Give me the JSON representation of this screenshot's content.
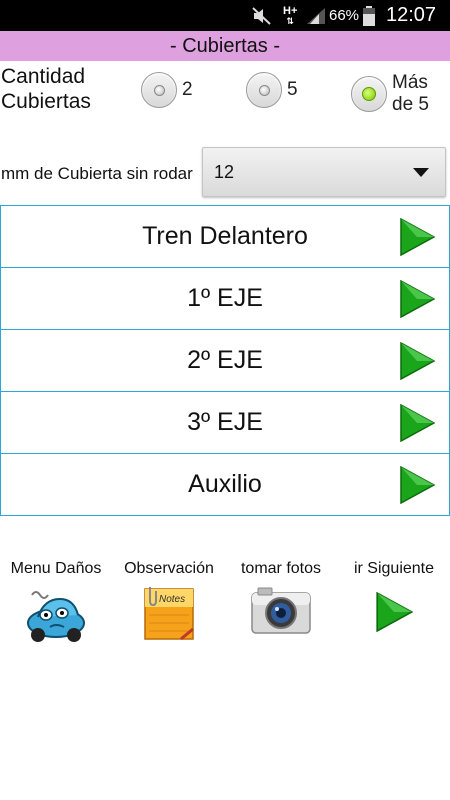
{
  "status_bar": {
    "network": "H+",
    "battery_percent": "66%",
    "time": "12:07"
  },
  "title": "- Cubiertas -",
  "quantity": {
    "label": "Cantidad Cubiertas",
    "options": [
      {
        "label": "2",
        "selected": false
      },
      {
        "label": "5",
        "selected": false
      },
      {
        "label": "Más de 5",
        "selected": true
      }
    ]
  },
  "mm": {
    "label": "mm de Cubierta sin rodar",
    "value": "12"
  },
  "sections": [
    {
      "label": "Tren Delantero",
      "icon": "green-play-arrow-icon"
    },
    {
      "label": "1º EJE",
      "icon": "green-play-arrow-icon"
    },
    {
      "label": "2º EJE",
      "icon": "green-play-arrow-icon"
    },
    {
      "label": "3º EJE",
      "icon": "green-play-arrow-icon"
    },
    {
      "label": "Auxilio",
      "icon": "green-play-arrow-icon"
    }
  ],
  "tools": [
    {
      "label": "Menu Daños",
      "icon": "damaged-car-icon"
    },
    {
      "label": "Observación",
      "icon": "notes-icon",
      "icon_text": "Notes"
    },
    {
      "label": "tomar fotos",
      "icon": "camera-icon"
    },
    {
      "label": "ir Siguiente",
      "icon": "green-play-arrow-icon"
    }
  ],
  "colors": {
    "title_bar": "#dea0de",
    "row_border": "#2aa8d8",
    "arrow_green": "#1aa51a"
  }
}
